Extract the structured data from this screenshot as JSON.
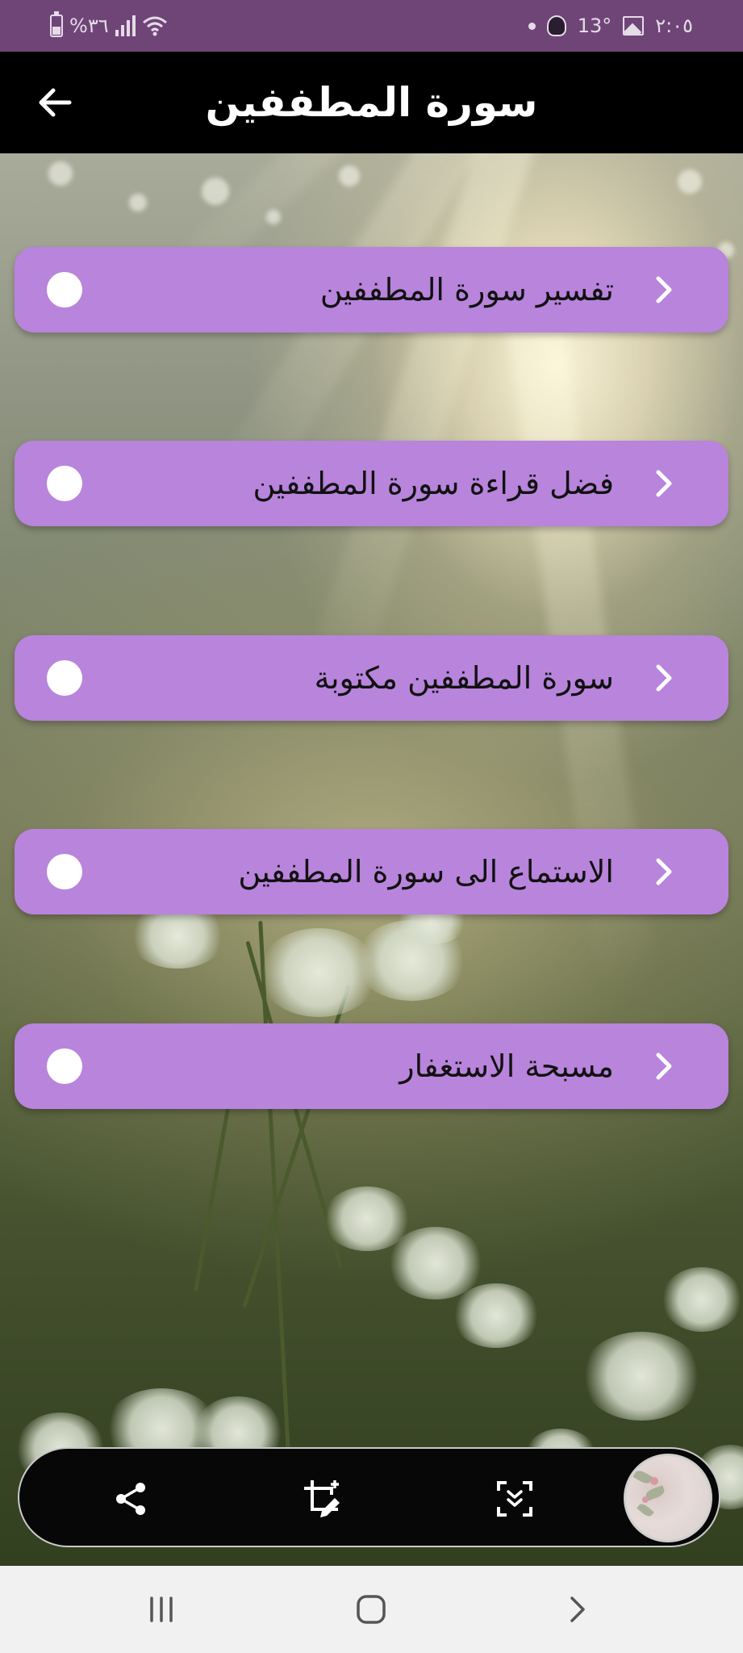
{
  "status_bar": {
    "battery_text": "%٣٦",
    "temperature": "13°",
    "time": "٢:٠٥",
    "icons": [
      "battery-icon",
      "signal-icon",
      "wifi-icon",
      "notification-dot-icon",
      "weather-icon",
      "gallery-icon"
    ]
  },
  "app_bar": {
    "title": "سورة المطففين",
    "back_icon": "arrow-left-icon"
  },
  "menu": {
    "items": [
      {
        "label": "تفسير سورة المطففين"
      },
      {
        "label": "فضل قراءة سورة المطففين"
      },
      {
        "label": "سورة المطففين مكتوبة"
      },
      {
        "label": "الاستماع الى سورة المطففين"
      },
      {
        "label": "مسبحة الاستغفار"
      }
    ],
    "item_color": "#b884dc",
    "chevron_icon": "chevron-right-icon",
    "radio_icon": "radio-circle-icon"
  },
  "toolbar": {
    "icons": [
      "share-icon",
      "crop-edit-icon",
      "scroll-capture-icon",
      "image-thumbnail"
    ]
  },
  "system_nav": {
    "icons": [
      "recent-apps-icon",
      "home-icon",
      "back-icon"
    ]
  },
  "colors": {
    "status_bar": "#6f4578",
    "app_bar": "#000000",
    "menu_item": "#b884dc",
    "toolbar": "#070707",
    "system_nav": "#f1f1f1"
  }
}
